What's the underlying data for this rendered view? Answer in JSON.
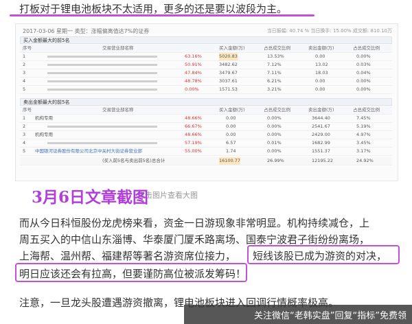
{
  "top_text": "打板对于锂电池板块不太适用，更多的还是要以波段为主。",
  "screenshot": {
    "header": "2017-03-06 星期一  类型：涨幅偏离值达7%的证券",
    "right_info": "当日振幅: 40.74 %   当日换手: 15.00%   成交额: 810.10万",
    "buy_title": "买入金额最大的前5名",
    "columns": [
      "序号",
      "交易营业部名称",
      "",
      "买入金额(万)",
      "占总成交比例",
      "卖出金额(万)",
      "占总成交比例"
    ],
    "buy_rows": [
      {
        "idx": "1",
        "pct": "63.16%",
        "buy": "5020.83",
        "bratio": "13.53%",
        "sell": "0.00",
        "sratio": "0.00%"
      },
      {
        "idx": "2",
        "pct": "50.91%",
        "buy": "3482.62",
        "bratio": "7.12%",
        "sell": "13.02",
        "sratio": "0.03%"
      },
      {
        "idx": "3",
        "pct": "47.84%",
        "buy": "3479.67",
        "bratio": "7.11%",
        "sell": "18.03",
        "sratio": "0.04%"
      },
      {
        "idx": "4",
        "pct": "48.78%",
        "buy": "3037.61",
        "bratio": "6.21%",
        "sell": "0.00",
        "sratio": "0.00%"
      },
      {
        "idx": "5",
        "pct": "0.00%",
        "buy": "1571.53",
        "bratio": "3.21%",
        "sell": "0.00",
        "sratio": "0.00%"
      }
    ],
    "sell_title": "卖出金额最大的前5名",
    "sell_rows": [
      {
        "idx": "1",
        "name": "机构专用",
        "pct": "48.66%",
        "buy": "0.00",
        "bratio": "0.00%",
        "sell": "3644.40",
        "sratio": "7.45%"
      },
      {
        "idx": "2",
        "name": "",
        "pct": "66.67%",
        "buy": "0.00",
        "bratio": "0.00%",
        "sell": "2541.67",
        "sratio": "5.19%"
      },
      {
        "idx": "3",
        "name": "机构专用",
        "pct": "48.66%",
        "buy": "0.00",
        "bratio": "0.00%",
        "sell": "2429.00",
        "sratio": "4.97%"
      },
      {
        "idx": "4",
        "name": "",
        "pct": "57.19%",
        "buy": "6.57",
        "bratio": "0.01%",
        "sell": "1682.99",
        "sratio": "3.45%"
      },
      {
        "idx": "5",
        "name": "中国银河证券股份有限公司北京中关村大街证券营业部",
        "pct": "55.00%",
        "buy": "1.74",
        "bratio": "0.00%",
        "sell": "1551.37",
        "sratio": "3.17%"
      }
    ],
    "sum_row": {
      "label": "(买入前5名与卖出前5名)总合计",
      "buy": "16100.77",
      "bratio": "26.99%",
      "sell": "12195.22",
      "sratio": "24.92%"
    }
  },
  "click_hint": "点击图片查看大图",
  "date_title": "3月6日文章截图",
  "para1_line1": "而从今日科恒股份龙虎榜来看，资金一日游现象非常明显。机构持续减仓，上",
  "para1_line2": "周五买入的中信山东淄博、华泰厦门厦禾路离场、国泰宁波君子街纷纷离场，",
  "para1_line3a": "上海帮、温州帮、福建帮等著名游资席位接力，",
  "para1_line3b": "短线该股已成为游资的对决，",
  "para1_line4": "明日应该还会有拉高，但要谨防高位被派发筹码！",
  "para2": "注意，一旦龙头股遭遇游资撤离，锂电池板块进入回调行情概率极高。",
  "watermark": "关注微信“老韩实盘”回复“指标”免费领"
}
